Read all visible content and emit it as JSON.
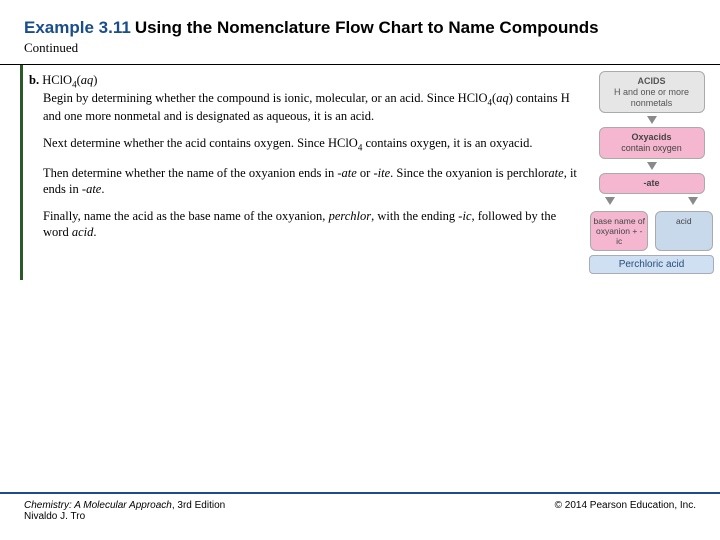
{
  "header": {
    "example_label": "Example 3.11",
    "title": "Using the Nomenclature Flow Chart to Name Compounds",
    "continued": "Continued"
  },
  "body": {
    "item_label": "b.",
    "formula_html": "HClO<span class=\"sub\">4</span>(<span class=\"ital\">aq</span>)",
    "p1a": "Begin by determining whether the compound is ionic, molecular, or an acid. Since HClO",
    "p1b": "(",
    "p1c": ") contains H and one more nonmetal and is designated as aqueous, it is an acid.",
    "p2a": "Next determine whether the acid contains oxygen. Since HClO",
    "p2b": " contains oxygen, it is an oxyacid.",
    "p3a": "Then determine whether the name of the oxyanion ends in -",
    "p3_ate": "ate",
    "p3b": " or -",
    "p3_ite": "ite",
    "p3c": ". Since the oxyanion is perchlor",
    "p3d": ", it ends in -",
    "p3e": ".",
    "p4a": "Finally, name the acid as the base name of the oxyanion, ",
    "p4_base": "perchlor",
    "p4b": ", with the ending -",
    "p4_ic": "ic",
    "p4c": ", followed by the word ",
    "p4_acid": "acid",
    "p4d": "."
  },
  "flowchart": {
    "box1_label": "ACIDS",
    "box1_sub": "H and one or more nonmetals",
    "box2_label": "Oxyacids",
    "box2_sub": "contain oxygen",
    "box3": "-ate",
    "box4a": "base name of oxyanion + -ic",
    "box4b": "acid",
    "result": "Perchloric acid"
  },
  "footer": {
    "book_title": "Chemistry: A Molecular Approach",
    "edition": ", 3rd Edition",
    "author": "Nivaldo J. Tro",
    "copyright": "© 2014 Pearson Education, Inc."
  }
}
